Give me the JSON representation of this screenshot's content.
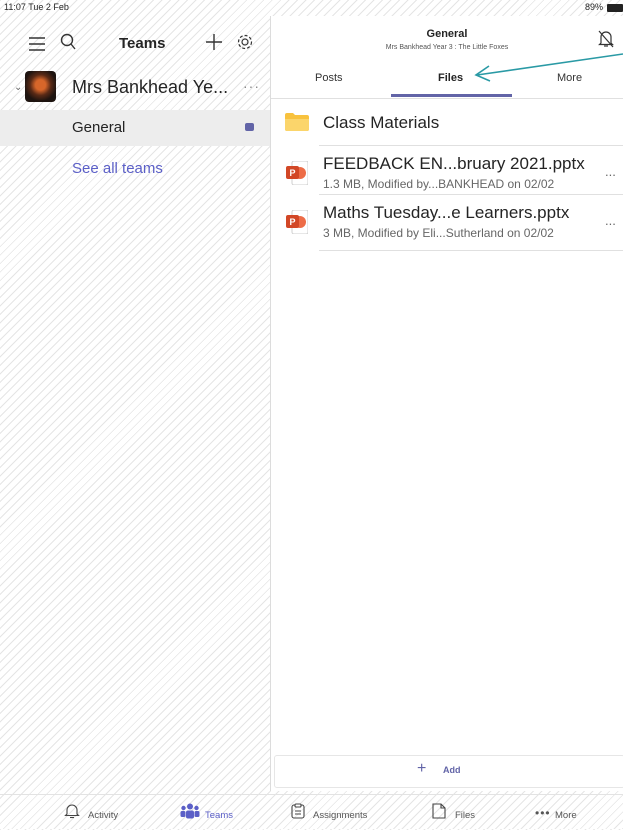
{
  "status_bar": {
    "time": "11:07  Tue 2 Feb",
    "battery": "89%"
  },
  "left_pane": {
    "title": "Teams",
    "team": {
      "name": "Mrs Bankhead Ye...",
      "more": "···"
    },
    "channel": {
      "name": "General"
    },
    "see_all": "See all teams"
  },
  "right_pane": {
    "channel_title": "General",
    "channel_subtitle": "Mrs Bankhead Year 3 : The Little Foxes",
    "tabs": [
      {
        "label": "Posts",
        "active": false
      },
      {
        "label": "Files",
        "active": true
      },
      {
        "label": "More",
        "active": false
      }
    ],
    "folder": {
      "name": "Class Materials"
    },
    "files": [
      {
        "name": "FEEDBACK EN...bruary 2021.pptx",
        "meta": "1.3 MB, Modified by...BANKHEAD on 02/02",
        "more": "..."
      },
      {
        "name": "Maths Tuesday...e Learners.pptx",
        "meta": "3 MB, Modified by Eli...Sutherland on 02/02",
        "more": "..."
      }
    ],
    "add_label": "Add",
    "add_plus": "+"
  },
  "bottom_nav": [
    {
      "label": "Activity",
      "icon": "bell-icon"
    },
    {
      "label": "Teams",
      "icon": "teams-icon",
      "active": true
    },
    {
      "label": "Assignments",
      "icon": "assignments-icon"
    },
    {
      "label": "Files",
      "icon": "file-icon"
    },
    {
      "label": "More",
      "icon": "more-icon"
    }
  ],
  "colors": {
    "accent": "#6264a7",
    "link": "#5b5fc7",
    "folder": "#f8c23e",
    "ppt": "#d24726",
    "annotation_arrow": "#2a9aa5"
  }
}
